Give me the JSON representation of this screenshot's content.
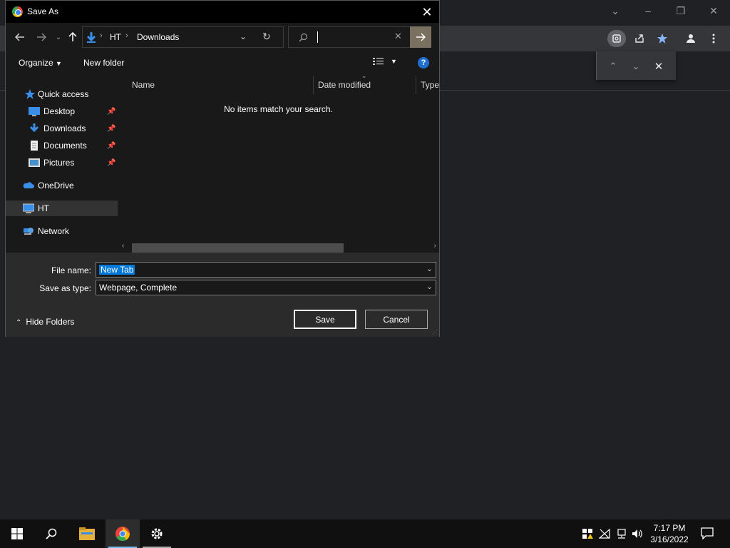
{
  "dialog": {
    "title": "Save As",
    "close_label": "✕",
    "address": {
      "segments": [
        "HT",
        "Downloads"
      ]
    },
    "search": {
      "value": "",
      "placeholder": ""
    },
    "commands": {
      "organize": "Organize",
      "new_folder": "New folder"
    },
    "nav_items": [
      {
        "label": "Quick access",
        "icon": "star-icon"
      },
      {
        "label": "Desktop",
        "icon": "desktop-icon",
        "pinned": true
      },
      {
        "label": "Downloads",
        "icon": "download-icon",
        "pinned": true
      },
      {
        "label": "Documents",
        "icon": "document-icon",
        "pinned": true
      },
      {
        "label": "Pictures",
        "icon": "picture-icon",
        "pinned": true
      },
      {
        "label": "OneDrive",
        "icon": "cloud-icon"
      },
      {
        "label": "HT",
        "icon": "computer-icon",
        "selected": true
      },
      {
        "label": "Network",
        "icon": "network-icon"
      }
    ],
    "columns": [
      "Name",
      "Date modified",
      "Type"
    ],
    "empty_message": "No items match your search.",
    "form": {
      "file_name_label": "File name:",
      "file_name_value": "New Tab",
      "save_type_label": "Save as type:",
      "save_type_value": "Webpage, Complete",
      "hide_folders": "Hide Folders",
      "save_button": "Save",
      "cancel_button": "Cancel"
    }
  },
  "taskbar": {
    "time": "7:17 PM",
    "date": "3/16/2022"
  },
  "colors": {
    "accent": "#0078d7",
    "dialog_bg": "#191919",
    "chrome_bg": "#202124"
  }
}
